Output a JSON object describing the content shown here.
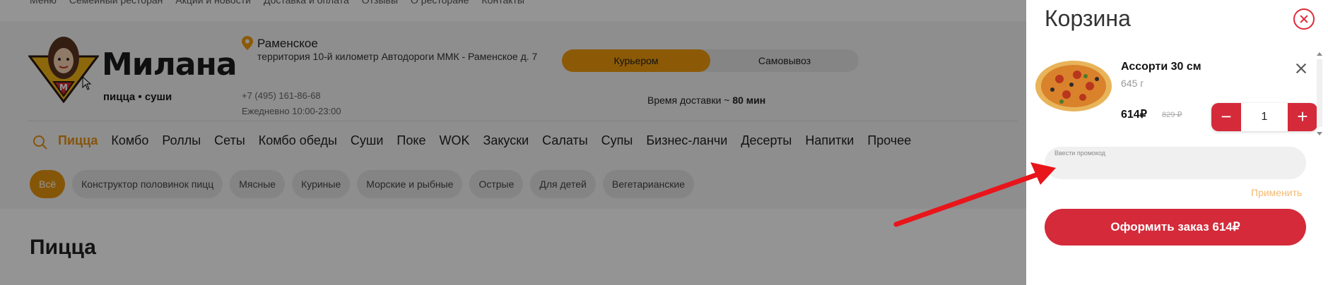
{
  "top_nav": [
    "Меню",
    "Семейный ресторан",
    "Акции и новости",
    "Доставка и оплата",
    "Отзывы",
    "О ресторане",
    "Контакты"
  ],
  "logo": {
    "name": "Милана",
    "subtitle": "пицца • суши"
  },
  "address": {
    "city": "Раменское",
    "street": "территория 10-й километр Автодороги ММК - Раменское д. 7",
    "phone": "+7 (495) 161-86-68",
    "hours": "Ежедневно 10:00-23:00"
  },
  "delivery": {
    "courier_label": "Курьером",
    "pickup_label": "Самовывоз",
    "time_label": "Время доставки ~",
    "time_value": "80 мин"
  },
  "menu": [
    "Пицца",
    "Комбо",
    "Роллы",
    "Сеты",
    "Комбо обеды",
    "Суши",
    "Поке",
    "WOK",
    "Закуски",
    "Салаты",
    "Супы",
    "Бизнес-ланчи",
    "Десерты",
    "Напитки",
    "Прочее"
  ],
  "filters": [
    "Всё",
    "Конструктор половинок пицц",
    "Мясные",
    "Куриные",
    "Морские и рыбные",
    "Острые",
    "Для детей",
    "Вегетарианские"
  ],
  "page_title": "Пицца",
  "cart": {
    "title": "Корзина",
    "item": {
      "name": "Ассорти 30 см",
      "weight": "645 г",
      "price": "614₽",
      "old_price": "829 ₽",
      "quantity": "1"
    },
    "qty_minus": "−",
    "qty_plus": "+",
    "promo_placeholder": "Ввести промокод",
    "apply_label": "Применить",
    "checkout_label": "Оформить заказ 614₽"
  },
  "colors": {
    "accent_orange": "#f29b0d",
    "accent_red": "#d42a3a",
    "annotation_arrow": "#e8151b"
  }
}
